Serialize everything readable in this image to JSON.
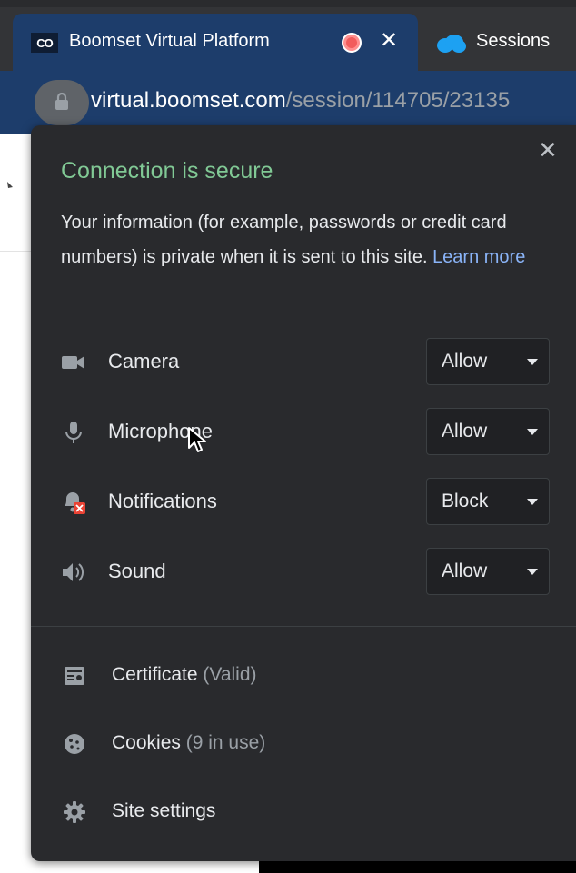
{
  "tabs": [
    {
      "favicon_text": "CO",
      "title": "Boomset Virtual Platform",
      "close_label": "✕"
    },
    {
      "title": "Sessions"
    }
  ],
  "address": {
    "url_host": "virtual.boomset.com",
    "url_path": "/session/114705/23135"
  },
  "popup": {
    "close_label": "✕",
    "heading": "Connection is secure",
    "info_text": "Your information (for example, passwords or credit card numbers) is private when it is sent to this site.",
    "learn_more": "Learn more",
    "permissions": [
      {
        "icon": "camera-icon",
        "label": "Camera",
        "value": "Allow"
      },
      {
        "icon": "microphone-icon",
        "label": "Microphone",
        "value": "Allow"
      },
      {
        "icon": "notifications-blocked-icon",
        "label": "Notifications",
        "value": "Block"
      },
      {
        "icon": "sound-icon",
        "label": "Sound",
        "value": "Allow"
      }
    ],
    "menu": [
      {
        "icon": "certificate-icon",
        "label": "Certificate",
        "sub": "(Valid)"
      },
      {
        "icon": "cookie-icon",
        "label": "Cookies",
        "sub": "(9 in use)"
      },
      {
        "icon": "gear-icon",
        "label": "Site settings",
        "sub": ""
      }
    ]
  },
  "colors": {
    "tab_active": "#1d3d6b",
    "popup_bg": "#292a2d",
    "secure_green": "#81c995",
    "link_blue": "#8ab4f8",
    "block_badge_red": "#ea4335"
  }
}
